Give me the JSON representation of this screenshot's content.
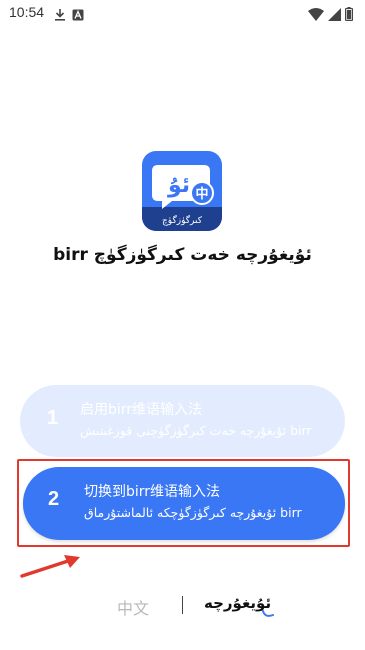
{
  "status_bar": {
    "time": "10:54",
    "icons": [
      "download-icon",
      "notification-a-icon",
      "wifi-icon",
      "signal-icon",
      "battery-icon"
    ]
  },
  "app": {
    "logo_glyph": "ئۇ",
    "logo_badge": "中",
    "logo_caption": "كىرگۈزگۈچ",
    "name": "ئۇيغۇرچە خەت كىرگۈزگۈچ birr"
  },
  "steps": [
    {
      "number": "1",
      "title": "启用birr维语输入法",
      "subtitle": "ئۇيغۇرچە خەت كىرگۈزگۈچنى قوزغىتىش birr",
      "state": "done"
    },
    {
      "number": "2",
      "title": "切换到birr维语输入法",
      "subtitle": "ئۇيغۇرچە كىرگۈزگۈچكە ئالماشتۇرماق birr",
      "state": "active"
    }
  ],
  "language": {
    "chinese": "中文",
    "uyghur": "ئۇيغۇرچە"
  },
  "colors": {
    "accent": "#3a77f5",
    "disabled": "#e3ecfe",
    "highlight": "#e03a2e"
  }
}
